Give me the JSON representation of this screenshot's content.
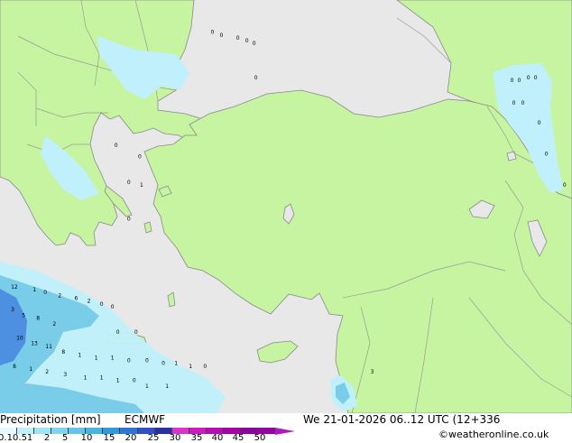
{
  "footer": {
    "title": "Precipitation [mm]",
    "model": "ECMWF",
    "datetime": "We 21-01-2026 06..12 UTC (12+336",
    "credit": "©weatheronline.co.uk"
  },
  "legend": {
    "ticks": [
      "0.1",
      "0.5",
      "1",
      "2",
      "5",
      "10",
      "15",
      "20",
      "25",
      "30",
      "35",
      "40",
      "45",
      "50"
    ],
    "colors": [
      "#e8f8ff",
      "#c0f0fc",
      "#9ce4f6",
      "#7ed6ee",
      "#62c6e8",
      "#46b6e0",
      "#2f9adc",
      "#2f74d8",
      "#2f50c8",
      "#2830a8",
      "#d834d0",
      "#c81cc0",
      "#b80ab8",
      "#a800a8",
      "#9000a0",
      "#9800a8"
    ],
    "overflow_color": "#b018c0"
  },
  "map_colors": {
    "land": "#c6f4a0",
    "sea": "#e8e8e8",
    "border": "#9a9a9a",
    "precip_light": "#bff0fb",
    "precip_medium": "#79cde8",
    "precip_heavy": "#4d8fe0"
  },
  "precip_values": [
    {
      "label": "0",
      "lat": 45.2,
      "lon": 26.0
    },
    {
      "label": "0",
      "lat": 45.1,
      "lon": 26.5
    },
    {
      "label": "0",
      "lat": 45.0,
      "lon": 27.4
    },
    {
      "label": "0",
      "lat": 44.9,
      "lon": 27.9
    },
    {
      "label": "0",
      "lat": 44.8,
      "lon": 28.3
    },
    {
      "label": "0",
      "lat": 43.6,
      "lon": 28.4
    },
    {
      "label": "0",
      "lat": 43.5,
      "lon": 42.5
    },
    {
      "label": "0",
      "lat": 43.5,
      "lon": 42.9
    },
    {
      "label": "0",
      "lat": 43.6,
      "lon": 43.4
    },
    {
      "label": "0",
      "lat": 43.6,
      "lon": 43.8
    },
    {
      "label": "0",
      "lat": 42.7,
      "lon": 42.6
    },
    {
      "label": "0",
      "lat": 42.7,
      "lon": 43.1
    },
    {
      "label": "0",
      "lat": 42.0,
      "lon": 44.0
    },
    {
      "label": "0",
      "lat": 40.9,
      "lon": 44.4
    },
    {
      "label": "0",
      "lat": 39.8,
      "lon": 45.4
    },
    {
      "label": "0",
      "lat": 41.2,
      "lon": 20.7
    },
    {
      "label": "0",
      "lat": 40.8,
      "lon": 22.0
    },
    {
      "label": "0",
      "lat": 39.9,
      "lon": 21.4
    },
    {
      "label": "1",
      "lat": 39.8,
      "lon": 22.1
    },
    {
      "label": "0",
      "lat": 38.6,
      "lon": 21.4
    },
    {
      "label": "12",
      "lat": 36.2,
      "lon": 15.0
    },
    {
      "label": "1",
      "lat": 36.1,
      "lon": 16.2
    },
    {
      "label": "0",
      "lat": 36.0,
      "lon": 16.8
    },
    {
      "label": "2",
      "lat": 35.9,
      "lon": 17.6
    },
    {
      "label": "6",
      "lat": 35.8,
      "lon": 18.5
    },
    {
      "label": "2",
      "lat": 35.7,
      "lon": 19.2
    },
    {
      "label": "0",
      "lat": 35.6,
      "lon": 19.9
    },
    {
      "label": "0",
      "lat": 35.5,
      "lon": 20.5
    },
    {
      "label": "3",
      "lat": 35.4,
      "lon": 15.0
    },
    {
      "label": "5",
      "lat": 35.2,
      "lon": 15.6
    },
    {
      "label": "8",
      "lat": 35.1,
      "lon": 16.4
    },
    {
      "label": "2",
      "lat": 34.9,
      "lon": 17.3
    },
    {
      "label": "0",
      "lat": 34.6,
      "lon": 20.8
    },
    {
      "label": "0",
      "lat": 34.6,
      "lon": 21.8
    },
    {
      "label": "10",
      "lat": 34.4,
      "lon": 15.3
    },
    {
      "label": "13",
      "lat": 34.2,
      "lon": 16.1
    },
    {
      "label": "11",
      "lat": 34.1,
      "lon": 16.9
    },
    {
      "label": "8",
      "lat": 33.9,
      "lon": 17.8
    },
    {
      "label": "1",
      "lat": 33.8,
      "lon": 18.7
    },
    {
      "label": "1",
      "lat": 33.7,
      "lon": 19.6
    },
    {
      "label": "1",
      "lat": 33.7,
      "lon": 20.5
    },
    {
      "label": "0",
      "lat": 33.6,
      "lon": 21.4
    },
    {
      "label": "0",
      "lat": 33.6,
      "lon": 22.4
    },
    {
      "label": "0",
      "lat": 33.5,
      "lon": 23.3
    },
    {
      "label": "1",
      "lat": 33.5,
      "lon": 24.0
    },
    {
      "label": "1",
      "lat": 33.4,
      "lon": 24.8
    },
    {
      "label": "0",
      "lat": 33.4,
      "lon": 25.6
    },
    {
      "label": "8",
      "lat": 33.4,
      "lon": 15.1
    },
    {
      "label": "1",
      "lat": 33.3,
      "lon": 16.0
    },
    {
      "label": "2",
      "lat": 33.2,
      "lon": 16.9
    },
    {
      "label": "3",
      "lat": 33.1,
      "lon": 17.9
    },
    {
      "label": "1",
      "lat": 33.0,
      "lon": 19.0
    },
    {
      "label": "1",
      "lat": 33.0,
      "lon": 19.9
    },
    {
      "label": "1",
      "lat": 32.9,
      "lon": 20.8
    },
    {
      "label": "0",
      "lat": 32.9,
      "lon": 21.7
    },
    {
      "label": "1",
      "lat": 32.7,
      "lon": 22.4
    },
    {
      "label": "1",
      "lat": 32.7,
      "lon": 23.5
    },
    {
      "label": "3",
      "lat": 33.2,
      "lon": 34.8
    }
  ]
}
